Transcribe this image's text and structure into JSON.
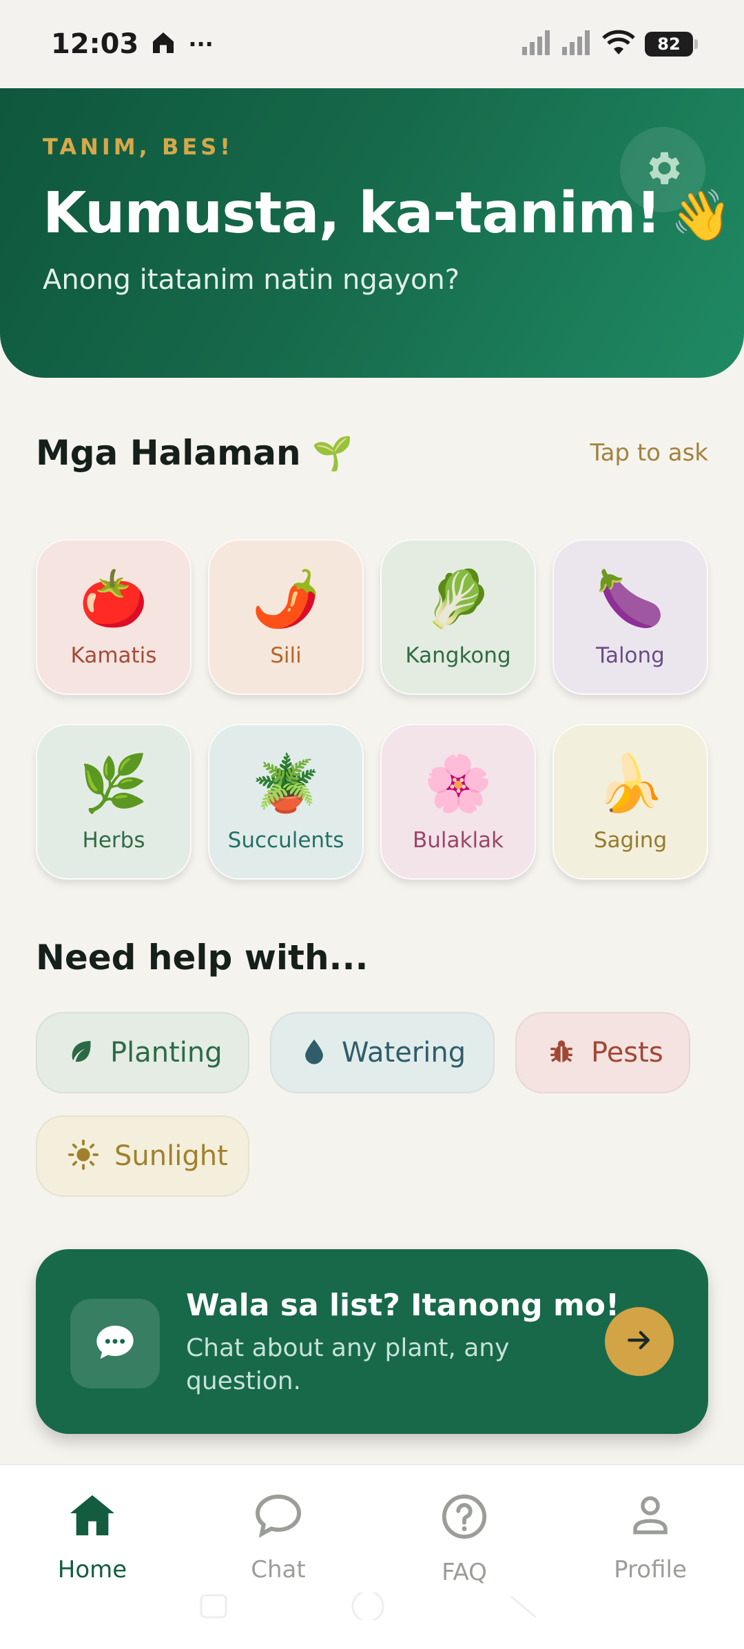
{
  "status_bar": {
    "time": "12:03",
    "more": "···",
    "battery": "82"
  },
  "header": {
    "eyebrow": "TANIM, BES!",
    "greeting": "Kumusta, ka-tanim!",
    "greeting_emoji": "👋",
    "subtitle": "Anong itatanim natin ngayon?",
    "settings_icon": "gear-icon"
  },
  "plants_section": {
    "title": "Mga Halaman",
    "title_emoji": "🌱",
    "action": "Tap to ask",
    "items": [
      {
        "label": "Kamatis",
        "emoji": "🍅",
        "bg": "#f5e4e0",
        "color": "#a64b38"
      },
      {
        "label": "Sili",
        "emoji": "🌶️",
        "bg": "#f6e7dc",
        "color": "#b5652a"
      },
      {
        "label": "Kangkong",
        "emoji": "🥬",
        "bg": "#e4ece2",
        "color": "#2f6c45"
      },
      {
        "label": "Talong",
        "emoji": "🍆",
        "bg": "#ebe6ee",
        "color": "#6a4c86"
      },
      {
        "label": "Herbs",
        "emoji": "🌿",
        "bg": "#e3ece4",
        "color": "#2f6c45"
      },
      {
        "label": "Succulents",
        "emoji": "🪴",
        "bg": "#e1ecea",
        "color": "#247066"
      },
      {
        "label": "Bulaklak",
        "emoji": "🌸",
        "bg": "#f3e4ea",
        "color": "#9b4566"
      },
      {
        "label": "Saging",
        "emoji": "🍌",
        "bg": "#f3efdd",
        "color": "#967a2a"
      }
    ]
  },
  "help_section": {
    "title": "Need help with...",
    "chips": [
      {
        "label": "Planting",
        "icon": "leaf-icon",
        "bg": "#e4ece4",
        "color": "#2c6a46"
      },
      {
        "label": "Watering",
        "icon": "water-drop-icon",
        "bg": "#e2eceb",
        "color": "#2f5e6a"
      },
      {
        "label": "Pests",
        "icon": "bug-icon",
        "bg": "#f4e3e0",
        "color": "#a04836"
      },
      {
        "label": "Sunlight",
        "icon": "sun-icon",
        "bg": "#f3efdc",
        "color": "#a1802d"
      }
    ]
  },
  "cta": {
    "title": "Wala sa list? Itanong mo!",
    "subtitle": "Chat about any plant, any question.",
    "icon": "chat-bubble-icon",
    "arrow_icon": "arrow-right-icon"
  },
  "bottom_nav": {
    "items": [
      {
        "label": "Home",
        "icon": "home-icon",
        "active": true
      },
      {
        "label": "Chat",
        "icon": "chat-icon",
        "active": false
      },
      {
        "label": "FAQ",
        "icon": "help-circle-icon",
        "active": false
      },
      {
        "label": "Profile",
        "icon": "person-icon",
        "active": false
      }
    ]
  },
  "colors": {
    "brand_green": "#17694a",
    "accent_gold": "#d2a446",
    "background": "#f5f3ee"
  }
}
